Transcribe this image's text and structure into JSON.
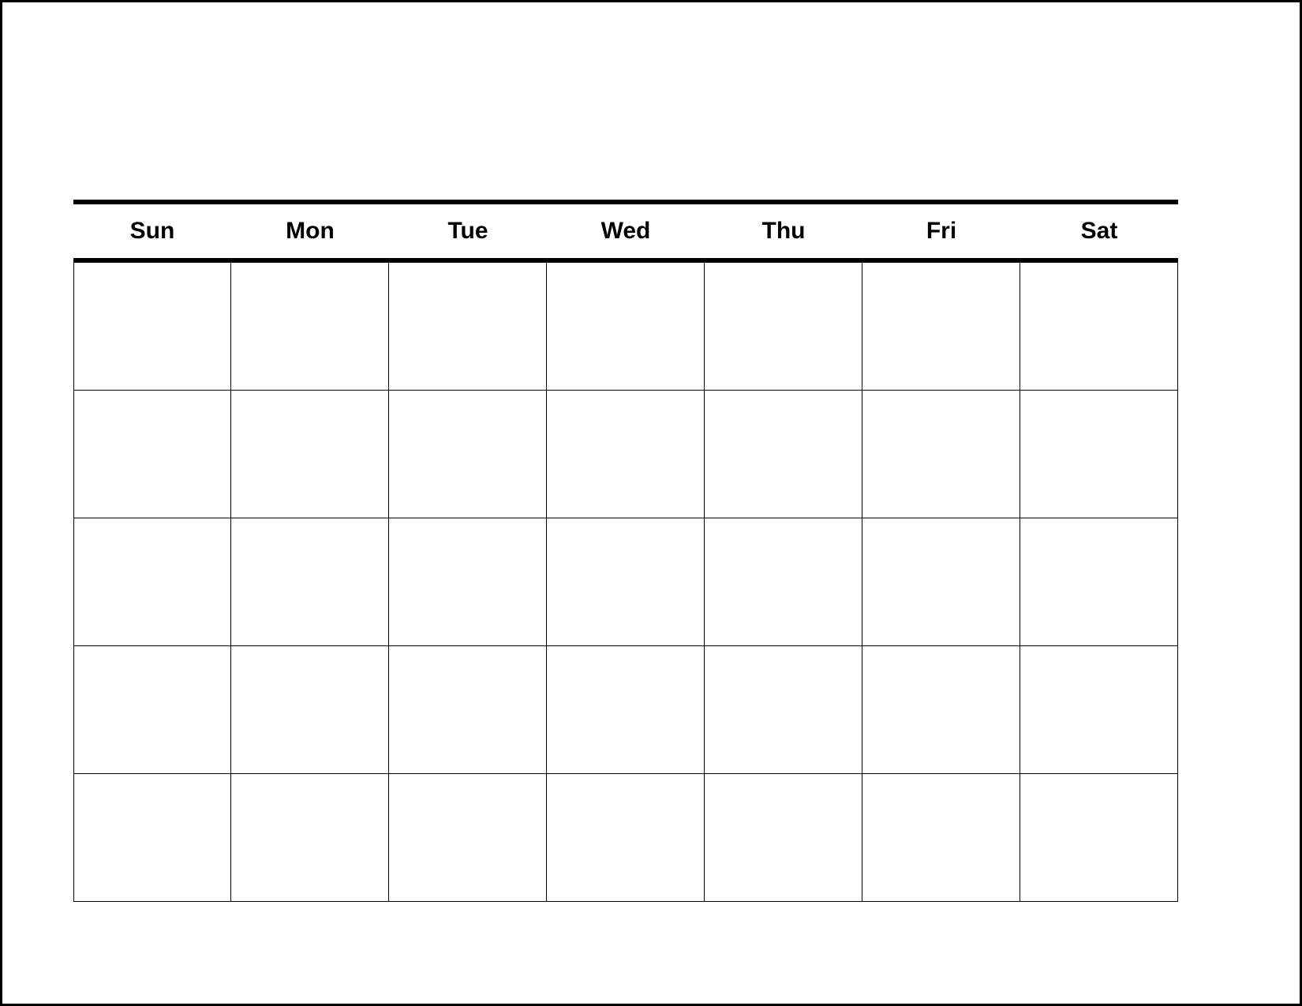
{
  "calendar": {
    "day_headers": [
      "Sun",
      "Mon",
      "Tue",
      "Wed",
      "Thu",
      "Fri",
      "Sat"
    ],
    "rows": 5,
    "cols": 7,
    "cells": [
      [
        "",
        "",
        "",
        "",
        "",
        "",
        ""
      ],
      [
        "",
        "",
        "",
        "",
        "",
        "",
        ""
      ],
      [
        "",
        "",
        "",
        "",
        "",
        "",
        ""
      ],
      [
        "",
        "",
        "",
        "",
        "",
        "",
        ""
      ],
      [
        "",
        "",
        "",
        "",
        "",
        "",
        ""
      ]
    ]
  }
}
